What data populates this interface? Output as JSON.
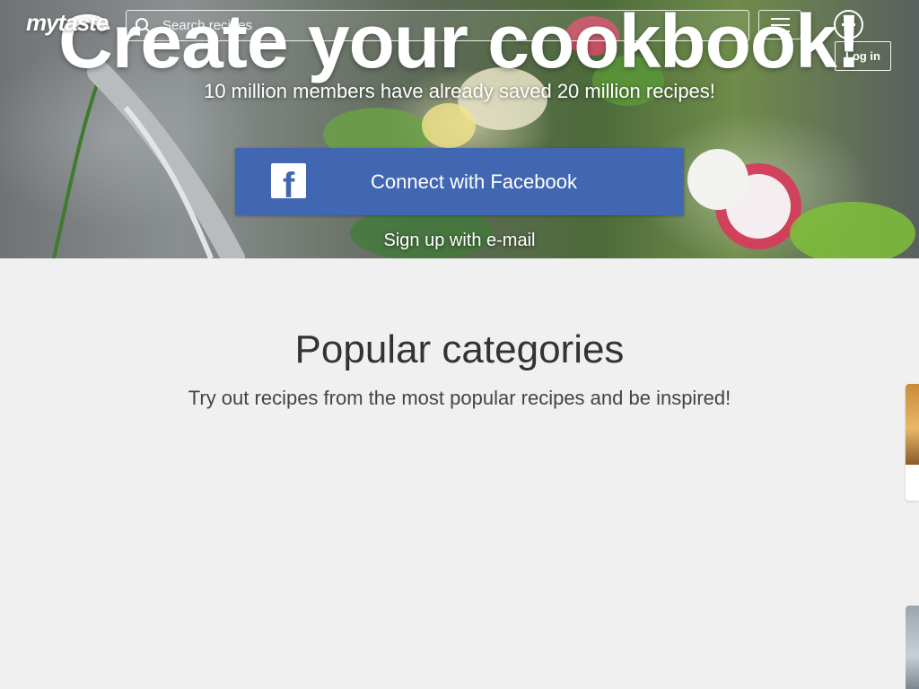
{
  "header": {
    "logo_text": "mytaste",
    "search_placeholder": "Search recipes",
    "login_label": "Log in"
  },
  "hero": {
    "title": "Create your cookbook!",
    "subtitle": "10 million members have already saved 20 million recipes!",
    "facebook_button_label": "Connect with Facebook",
    "signup_link": "Sign up with e-mail"
  },
  "categories": {
    "title": "Popular categories",
    "subtitle": "Try out recipes from the most popular recipes and be inspired!"
  },
  "colors": {
    "facebook_blue": "#4267b2",
    "page_background": "#f0f0f0",
    "heading_text": "#333333"
  },
  "icons": [
    "search-icon",
    "hamburger-menu-icon",
    "plus-icon",
    "facebook-icon"
  ]
}
